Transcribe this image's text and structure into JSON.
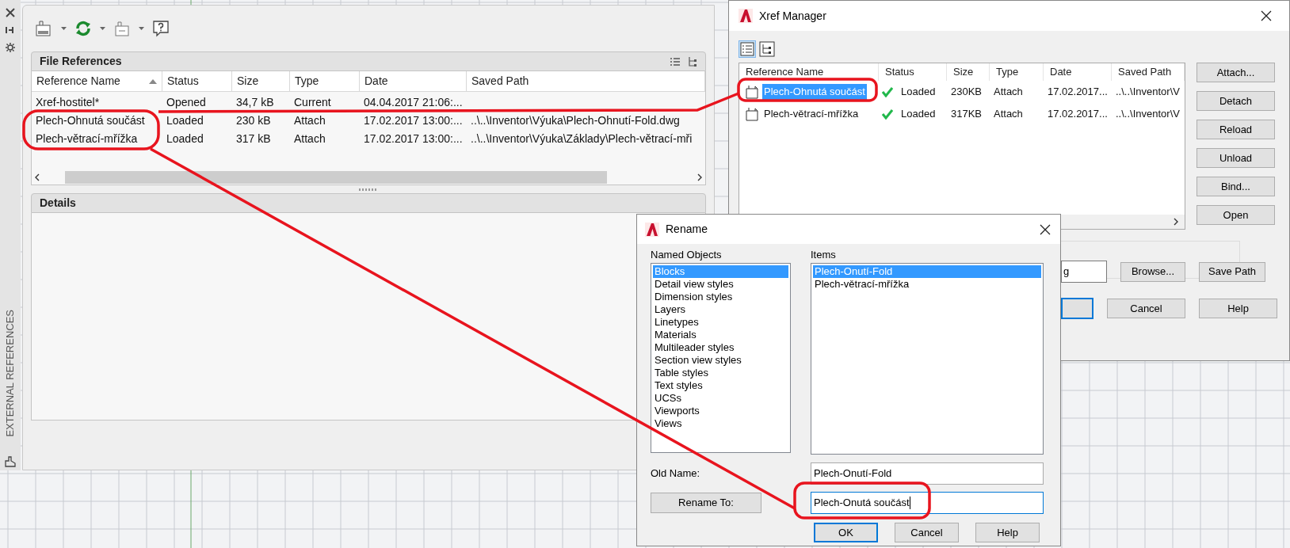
{
  "side_strip": {
    "title": "EXTERNAL REFERENCES"
  },
  "file_references": {
    "title": "File References",
    "columns": [
      "Reference Name",
      "Status",
      "Size",
      "Type",
      "Date",
      "Saved Path"
    ],
    "rows": [
      {
        "cells": [
          "Xref-hostitel*",
          "Opened",
          "34,7 kB",
          "Current",
          "04.04.2017 21:06:...",
          ""
        ]
      },
      {
        "cells": [
          "Plech-Ohnutá součást",
          "Loaded",
          "230 kB",
          "Attach",
          "17.02.2017 13:00:...",
          "..\\..\\Inventor\\Výuka\\Plech-Ohnutí-Fold.dwg"
        ]
      },
      {
        "cells": [
          "Plech-větrací-mřížka",
          "Loaded",
          "317 kB",
          "Attach",
          "17.02.2017 13:00:...",
          "..\\..\\Inventor\\Výuka\\Základy\\Plech-větrací-mři"
        ]
      }
    ]
  },
  "details": {
    "title": "Details"
  },
  "xref_manager": {
    "title": "Xref Manager",
    "columns": [
      "Reference Name",
      "Status",
      "Size",
      "Type",
      "Date",
      "Saved Path"
    ],
    "rows": [
      {
        "name": "Plech-Ohnutá součást",
        "status": "Loaded",
        "size": "230KB",
        "type": "Attach",
        "date": "17.02.2017...",
        "saved_path": "..\\..\\Inventor\\V",
        "selected": true
      },
      {
        "name": "Plech-větrací-mřížka",
        "status": "Loaded",
        "size": "317KB",
        "type": "Attach",
        "date": "17.02.2017...",
        "saved_path": "..\\..\\Inventor\\V",
        "selected": false
      }
    ],
    "side_buttons": [
      "Attach...",
      "Detach",
      "Reload",
      "Unload",
      "Bind...",
      "Open"
    ],
    "path_field": {
      "value": "g"
    },
    "path_buttons": [
      "Browse...",
      "Save Path"
    ],
    "bottom_buttons": [
      "Cancel",
      "Help"
    ]
  },
  "rename": {
    "title": "Rename",
    "named_objects_label": "Named Objects",
    "named_objects": [
      {
        "label": "Blocks",
        "selected": true
      },
      {
        "label": "Detail view styles",
        "selected": false
      },
      {
        "label": "Dimension styles",
        "selected": false
      },
      {
        "label": "Layers",
        "selected": false
      },
      {
        "label": "Linetypes",
        "selected": false
      },
      {
        "label": "Materials",
        "selected": false
      },
      {
        "label": "Multileader styles",
        "selected": false
      },
      {
        "label": "Section view styles",
        "selected": false
      },
      {
        "label": "Table styles",
        "selected": false
      },
      {
        "label": "Text styles",
        "selected": false
      },
      {
        "label": "UCSs",
        "selected": false
      },
      {
        "label": "Viewports",
        "selected": false
      },
      {
        "label": "Views",
        "selected": false
      }
    ],
    "items_label": "Items",
    "items": [
      {
        "label": "Plech-Onutí-Fold",
        "selected": true
      },
      {
        "label": "Plech-větrací-mřížka",
        "selected": false
      }
    ],
    "old_name_label": "Old Name:",
    "old_name": "Plech-Onutí-Fold",
    "rename_to_button": "Rename To:",
    "new_name": "Plech-Onutá součást",
    "buttons": [
      {
        "label": "OK",
        "default": true
      },
      {
        "label": "Cancel",
        "default": false
      },
      {
        "label": "Help",
        "default": false
      }
    ]
  }
}
